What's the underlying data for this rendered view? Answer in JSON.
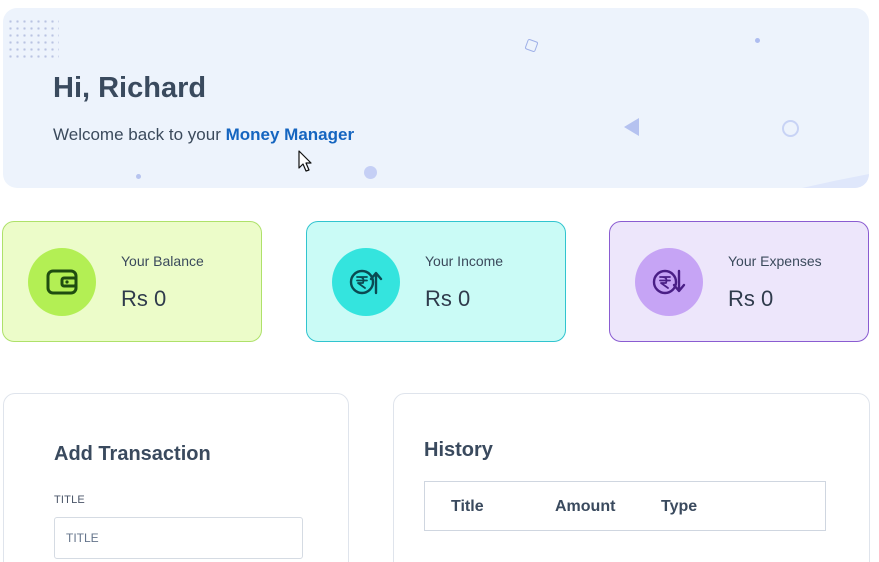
{
  "banner": {
    "greeting": "Hi, Richard",
    "welcome_prefix": "Welcome back to your ",
    "brand": "Money Manager"
  },
  "cards": {
    "balance": {
      "label": "Your Balance",
      "amount": "Rs 0",
      "icon": "wallet-icon"
    },
    "income": {
      "label": "Your Income",
      "amount": "Rs 0",
      "icon": "rupee-up-icon"
    },
    "expenses": {
      "label": "Your Expenses",
      "amount": "Rs 0",
      "icon": "rupee-down-icon"
    }
  },
  "add_transaction": {
    "title": "Add Transaction",
    "title_field_label": "TITLE",
    "title_field_placeholder": "TITLE",
    "title_field_value": ""
  },
  "history": {
    "title": "History",
    "columns": [
      "Title",
      "Amount",
      "Type"
    ]
  },
  "colors": {
    "brand": "#1565c0",
    "balance_bg": "#ecfcc9",
    "income_bg": "#cafbf6",
    "expenses_bg": "#ede6fb"
  }
}
